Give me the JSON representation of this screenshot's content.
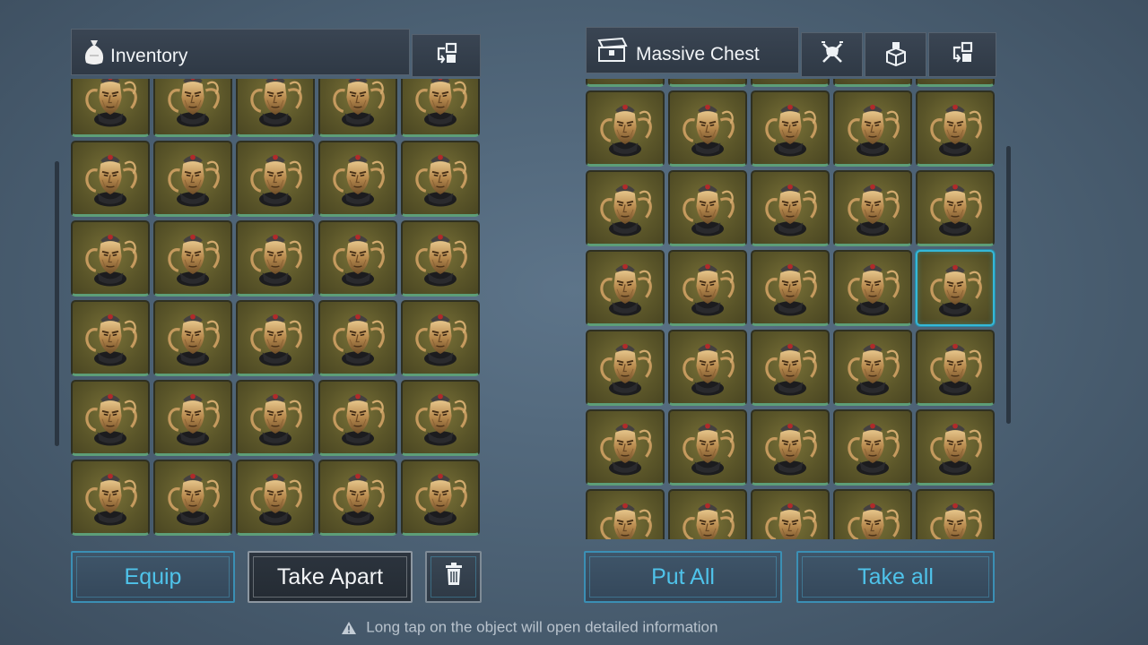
{
  "inventory": {
    "title": "Inventory",
    "header_icon": "money-bag-icon",
    "sort_icon": "sort-transfer-icon",
    "item_icon": "horned-helmet-icon",
    "columns": 5,
    "visible_rows": 6
  },
  "chest": {
    "title": "Massive Chest",
    "header_icon": "chest-icon",
    "header_buttons": [
      "crossed-swords-icon",
      "box-stack-icon",
      "sort-transfer-icon"
    ],
    "item_icon": "horned-helmet-icon",
    "columns": 5,
    "visible_rows": 6,
    "selected_slot": {
      "row": 3,
      "column": 5
    }
  },
  "actions": {
    "equip": "Equip",
    "take_apart": "Take Apart",
    "delete_icon": "trash-icon",
    "put_all": "Put All",
    "take_all": "Take all"
  },
  "hint": {
    "icon": "warning-icon",
    "text": "Long tap on the object will open detailed information"
  },
  "colors": {
    "accent": "#4fc3ea",
    "slot_fill": "#5a5529",
    "slot_rarity_bar": "#5d9e78",
    "selected_border": "#35b8d8"
  }
}
